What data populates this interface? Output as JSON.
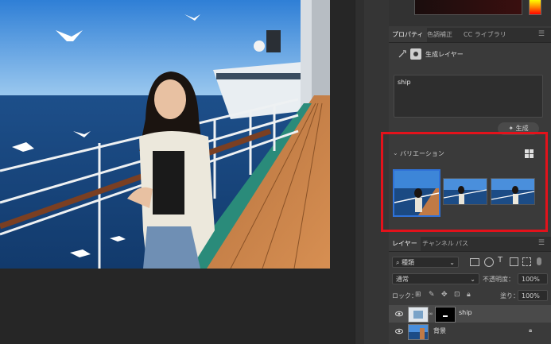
{
  "colors": {
    "accent_selection": "#2f72d8",
    "highlight_frame": "#e3121b"
  },
  "properties_tabs": [
    {
      "label": "プロパティ",
      "active": true
    },
    {
      "label": "色調補正",
      "active": false
    },
    {
      "label": "CC ライブラリ",
      "active": false
    }
  ],
  "layer_type": {
    "label": "生成レイヤー",
    "icon": "generative-layer-icon"
  },
  "prompt": {
    "value": "ship"
  },
  "generate_button": {
    "label": "生成"
  },
  "variations": {
    "title": "バリエーション",
    "count": 3,
    "selected_index": 0
  },
  "layers_tabs": [
    {
      "label": "レイヤー",
      "active": true
    },
    {
      "label": "チャンネル",
      "active": false
    },
    {
      "label": "パス",
      "active": false
    }
  ],
  "filter": {
    "kind": "種類"
  },
  "blend": {
    "mode": "通常",
    "opacity_label": "不透明度：",
    "opacity": "100%"
  },
  "lock": {
    "label": "ロック：",
    "fill_label": "塗り：",
    "fill": "100%"
  },
  "layers": [
    {
      "name": "ship",
      "selected": true,
      "visible": true
    },
    {
      "name": "背景",
      "selected": false,
      "visible": true,
      "locked": true
    }
  ]
}
